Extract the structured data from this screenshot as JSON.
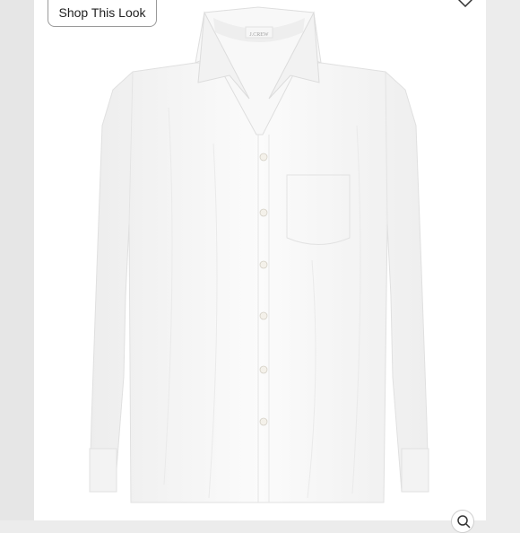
{
  "shop_button": {
    "label": "Shop This Look"
  },
  "product_image": {
    "brand_tag": "J.CREW"
  },
  "icons": {
    "like": "heart-icon",
    "zoom": "zoom-icon"
  }
}
